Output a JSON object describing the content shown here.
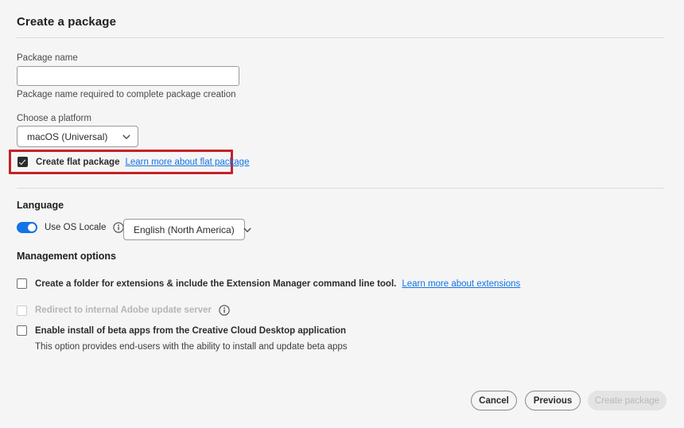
{
  "dialog": {
    "title": "Create a package"
  },
  "package_name": {
    "label": "Package name",
    "value": "",
    "placeholder": "",
    "helper": "Package name required to complete package creation"
  },
  "platform": {
    "label": "Choose a platform",
    "selected": "macOS (Universal)",
    "chevron_icon": "chevron-down-icon"
  },
  "flat_package": {
    "label": "Create flat package",
    "checked": true,
    "link": "Learn more about flat package",
    "highlight_color": "#c62127"
  },
  "language": {
    "heading": "Language",
    "toggle_label": "Use OS Locale",
    "toggle_on": true,
    "toggle_color": "#1473e6",
    "info_icon": "info-icon",
    "selected": "English (North America)",
    "chevron_icon": "chevron-down-icon"
  },
  "management": {
    "heading": "Management options",
    "options": [
      {
        "label": "Create a folder for extensions & include the Extension Manager command line tool.",
        "checked": false,
        "disabled": false,
        "link": "Learn more about extensions"
      },
      {
        "label": "Redirect to internal Adobe update server",
        "checked": false,
        "disabled": true,
        "info_icon": "info-icon"
      },
      {
        "label": "Enable install of beta apps from the Creative Cloud Desktop application",
        "checked": false,
        "disabled": false,
        "note": "This option provides end-users with the ability to install and update beta apps"
      }
    ]
  },
  "footer": {
    "cancel_label": "Cancel",
    "previous_label": "Previous",
    "create_label": "Create package",
    "create_disabled": true
  },
  "colors": {
    "background": "#f5f5f5",
    "link": "#1473e6",
    "accent": "#1473e6",
    "highlight": "#c62127"
  }
}
